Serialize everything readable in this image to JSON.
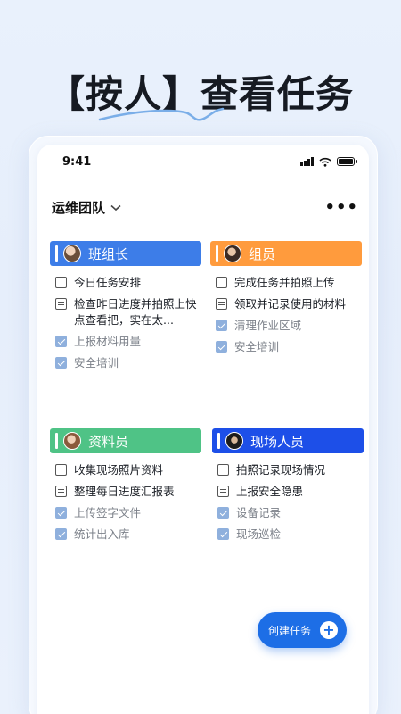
{
  "headline": "【按人】查看任务",
  "status": {
    "time": "9:41"
  },
  "team": {
    "name": "运维团队"
  },
  "colors": {
    "foreman": "#3d7de8",
    "member": "#ff9b3d",
    "clerk": "#4fc386",
    "field": "#1d4fe8"
  },
  "groups": [
    {
      "title": "班组长",
      "tasks": [
        {
          "text": "今日任务安排",
          "state": "unchecked"
        },
        {
          "text": "检查昨日进度并拍照上快点查看把，实在太...",
          "state": "list"
        },
        {
          "text": "上报材料用量",
          "state": "checked"
        },
        {
          "text": "安全培训",
          "state": "checked"
        }
      ]
    },
    {
      "title": "组员",
      "tasks": [
        {
          "text": "完成任务并拍照上传",
          "state": "unchecked"
        },
        {
          "text": "领取并记录使用的材料",
          "state": "list"
        },
        {
          "text": "清理作业区域",
          "state": "checked"
        },
        {
          "text": "安全培训",
          "state": "checked"
        }
      ]
    },
    {
      "title": "资料员",
      "tasks": [
        {
          "text": "收集现场照片资料",
          "state": "unchecked"
        },
        {
          "text": "整理每日进度汇报表",
          "state": "list"
        },
        {
          "text": "上传签字文件",
          "state": "checked"
        },
        {
          "text": "统计出入库",
          "state": "checked"
        }
      ]
    },
    {
      "title": "现场人员",
      "tasks": [
        {
          "text": "拍照记录现场情况",
          "state": "unchecked"
        },
        {
          "text": "上报安全隐患",
          "state": "list"
        },
        {
          "text": "设备记录",
          "state": "checked"
        },
        {
          "text": "现场巡检",
          "state": "checked"
        }
      ]
    }
  ],
  "create_button": {
    "label": "创建任务",
    "icon": "plus-icon"
  }
}
